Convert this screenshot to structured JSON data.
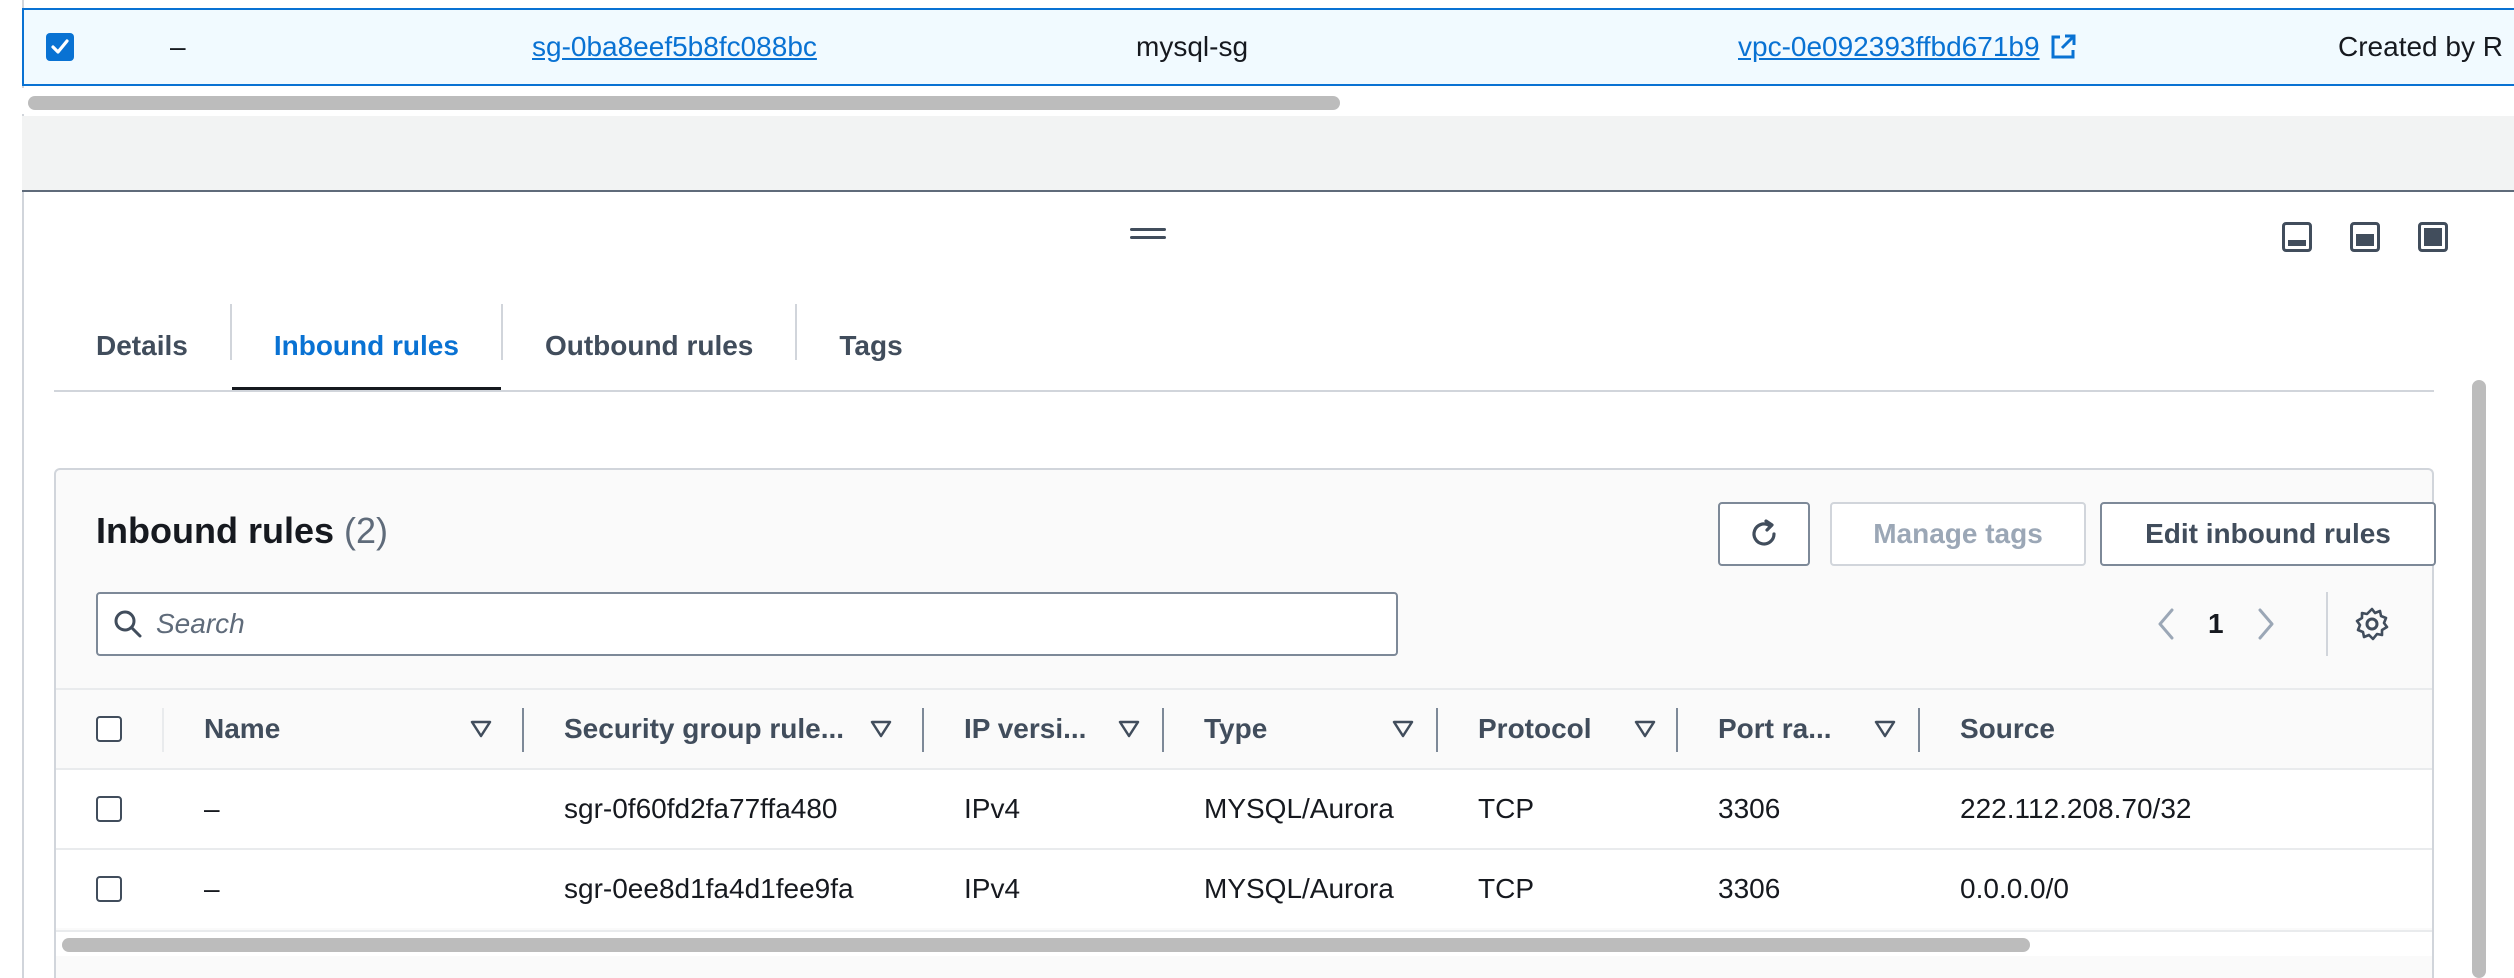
{
  "selected_row": {
    "dash": "–",
    "security_group_id": "sg-0ba8eef5b8fc088bc",
    "name": "mysql-sg",
    "vpc_id": "vpc-0e092393ffbd671b9",
    "description": "Created by R"
  },
  "tabs": [
    {
      "label": "Details"
    },
    {
      "label": "Inbound rules"
    },
    {
      "label": "Outbound rules"
    },
    {
      "label": "Tags"
    }
  ],
  "active_tab": "Inbound rules",
  "inbound": {
    "title": "Inbound rules",
    "count": "(2)",
    "manage_tags_label": "Manage tags",
    "edit_label": "Edit inbound rules",
    "search_placeholder": "Search",
    "page": "1",
    "columns": [
      "Name",
      "Security group rule...",
      "IP versi...",
      "Type",
      "Protocol",
      "Port ra...",
      "Source"
    ],
    "rows": [
      {
        "name": "–",
        "rule_id": "sgr-0f60fd2fa77ffa480",
        "ip_version": "IPv4",
        "type": "MYSQL/Aurora",
        "protocol": "TCP",
        "port_range": "3306",
        "source": "222.112.208.70/32"
      },
      {
        "name": "–",
        "rule_id": "sgr-0ee8d1fa4d1fee9fa",
        "ip_version": "IPv4",
        "type": "MYSQL/Aurora",
        "protocol": "TCP",
        "port_range": "3306",
        "source": "0.0.0.0/0"
      }
    ]
  },
  "colors": {
    "accent": "#0972d3",
    "text": "#16191f",
    "muted": "#414d5c",
    "border": "#d1d5db"
  }
}
